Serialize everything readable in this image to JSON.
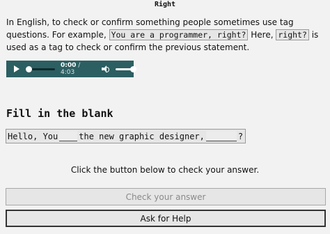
{
  "lesson": {
    "title": "Right",
    "intro_text_1": "In English, to check or confirm something people sometimes use tag questions. For example, ",
    "example_sentence": "You are a programmer, right?",
    "intro_text_2": " Here, ",
    "tag_word": "right?",
    "intro_text_3": " is used as a tag to check or confirm the previous statement."
  },
  "audio_player": {
    "current_time": "0:00",
    "separator": " / ",
    "duration": "4:03",
    "icons": [
      "play-icon",
      "speaker-icon"
    ],
    "progress": 0,
    "volume": 1.0,
    "background_color": "#2c5f62"
  },
  "exercise": {
    "heading": "Fill in the blank",
    "part_1": "Hello, You",
    "part_2": "the new graphic designer,",
    "part_3": "?",
    "instruction": "Click the button below to check your answer."
  },
  "buttons": {
    "check_label": "Check your answer",
    "help_label": "Ask for Help"
  }
}
